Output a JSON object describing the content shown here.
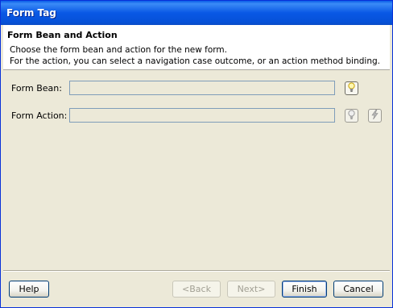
{
  "window": {
    "title": "Form Tag"
  },
  "header": {
    "title": "Form Bean and Action",
    "line1": "Choose the form bean and action for the new form.",
    "line2": "For the action, you can select a navigation case outcome, or an action method binding."
  },
  "fields": {
    "form_bean_label": "Form Bean:",
    "form_bean_value": "",
    "form_action_label": "Form Action:",
    "form_action_value": ""
  },
  "icons": {
    "bean_browse": "lightbulb-icon",
    "action_browse": "lightbulb-icon",
    "action_binding": "lightning-bolt-icon"
  },
  "buttons": {
    "help": "Help",
    "back": "<Back",
    "next": "Next>",
    "finish": "Finish",
    "cancel": "Cancel"
  }
}
